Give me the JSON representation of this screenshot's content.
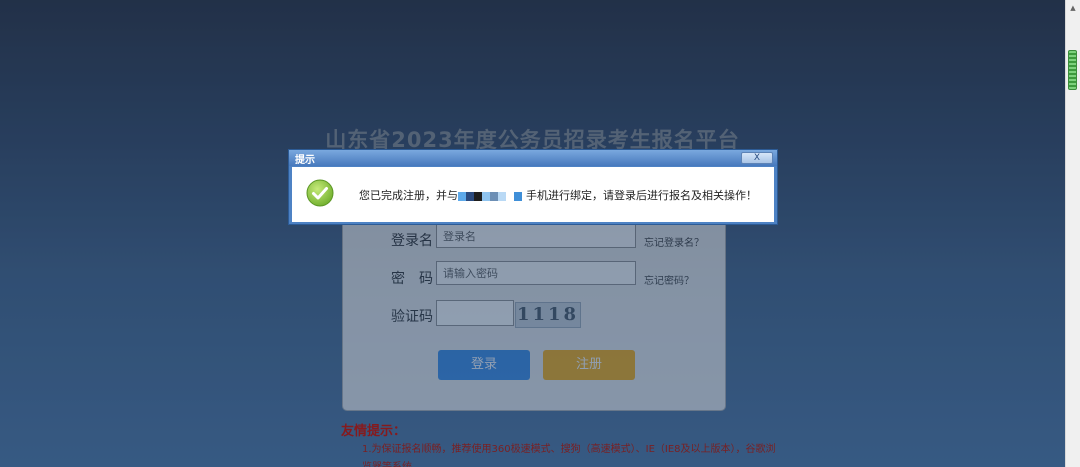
{
  "page": {
    "title": "山东省2023年度公务员招录考生报名平台"
  },
  "login_form": {
    "username_label": "登录名",
    "username_placeholder": "登录名",
    "forgot_username": "忘记登录名？",
    "password_label": "密　码",
    "password_placeholder": "请输入密码",
    "forgot_password": "忘记密码？",
    "captcha_label": "验证码",
    "captcha_value": "",
    "captcha_image_text": "1118",
    "login_button": "登录",
    "register_button": "注册"
  },
  "tips": {
    "title": "友情提示：",
    "line1": "1.为保证报名顺畅，推荐使用360极速模式、搜狗（高速模式）、IE（IE8及以上版本），谷歌浏览器等系统"
  },
  "dialog": {
    "title": "提示",
    "close_label": "X",
    "message_before": "您已完成注册，并与",
    "message_after": "手机进行绑定，请登录后进行报名及相关操作！",
    "icon": "check-circle-icon"
  },
  "colors": {
    "accent_blue": "#2a82e4",
    "accent_orange": "#f7a700",
    "dialog_frame": "#4d82c4",
    "success_green": "#8cc63f",
    "tips_red": "#9b1a1a"
  }
}
